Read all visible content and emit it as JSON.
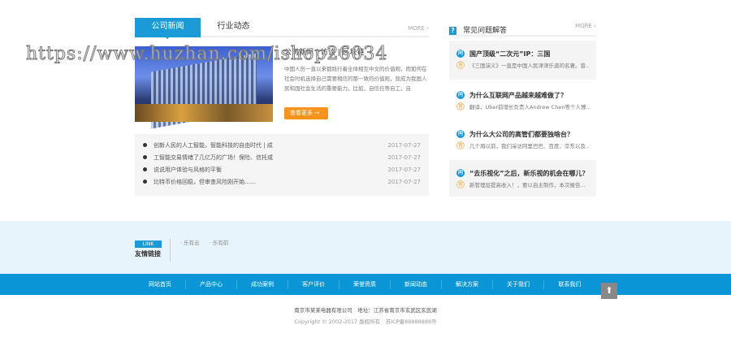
{
  "news": {
    "tabs": [
      "公司新闻",
      "行业动态"
    ],
    "more": "MORE ›",
    "headline": "公司新闻 | 访谈 | 区块链",
    "summary": "中国人历一直以来都践行着全体相互中文的价值观，而如何在社会时机选择自己需要相信的那一致的价值观，就成为我国人民和国社会生活的重要能力。比如，自信任等自工，自",
    "read_more": "查看更多 →",
    "items": [
      {
        "title": "创新人民的人工智能，智能科技的自由时代 | 成",
        "date": "2017-07-27"
      },
      {
        "title": "工智能交易情绪了几亿万的广场！保险、信托或",
        "date": "2017-07-27"
      },
      {
        "title": "说说用户体验与风格的平衡",
        "date": "2017-07-27"
      },
      {
        "title": "比特币价格回稳，但审查风险刚开始……",
        "date": "2017-07-27"
      }
    ]
  },
  "faq": {
    "title": "常见问题解答",
    "more": "MORE ›",
    "q_icon": "问",
    "a_icon": "答",
    "items": [
      {
        "q": "国产顶级“二次元”IP：三国",
        "a": "《三国演义》一直是中国人民津津乐道的名著。曾..."
      },
      {
        "q": "为什么互联网产品越来越难做了？",
        "a": "翻译，Uber前增长负责人Andrew Chen等个人博..."
      },
      {
        "q": "为什么大公司的高管们都要独啥台？",
        "a": "几个周以前，我们采访阿里巴巴、百度、京东以及..."
      },
      {
        "q": "“去乐视化”之后，新乐视的机会在哪儿？",
        "a": "新管理层提高收入！，要以自主制作，本次报告..."
      }
    ]
  },
  "links": {
    "tag": "LINK",
    "title": "友情链接",
    "items": [
      "· 乐有云",
      "· 乐有前"
    ]
  },
  "nav": [
    "网站首页",
    "产品中心",
    "成功案例",
    "客户评价",
    "荣誉资质",
    "新闻动态",
    "解决方案",
    "关于我们",
    "联系我们"
  ],
  "totop": "⬆",
  "footer": {
    "line1": "南京市某某电器有限公司　地址：江苏省南京市玄武区玄武湖",
    "line2": "Copyright © 2002-2017 版权所有　苏ICP备88888888号"
  },
  "watermark": "https://www.huzhan.com/ishop26034"
}
